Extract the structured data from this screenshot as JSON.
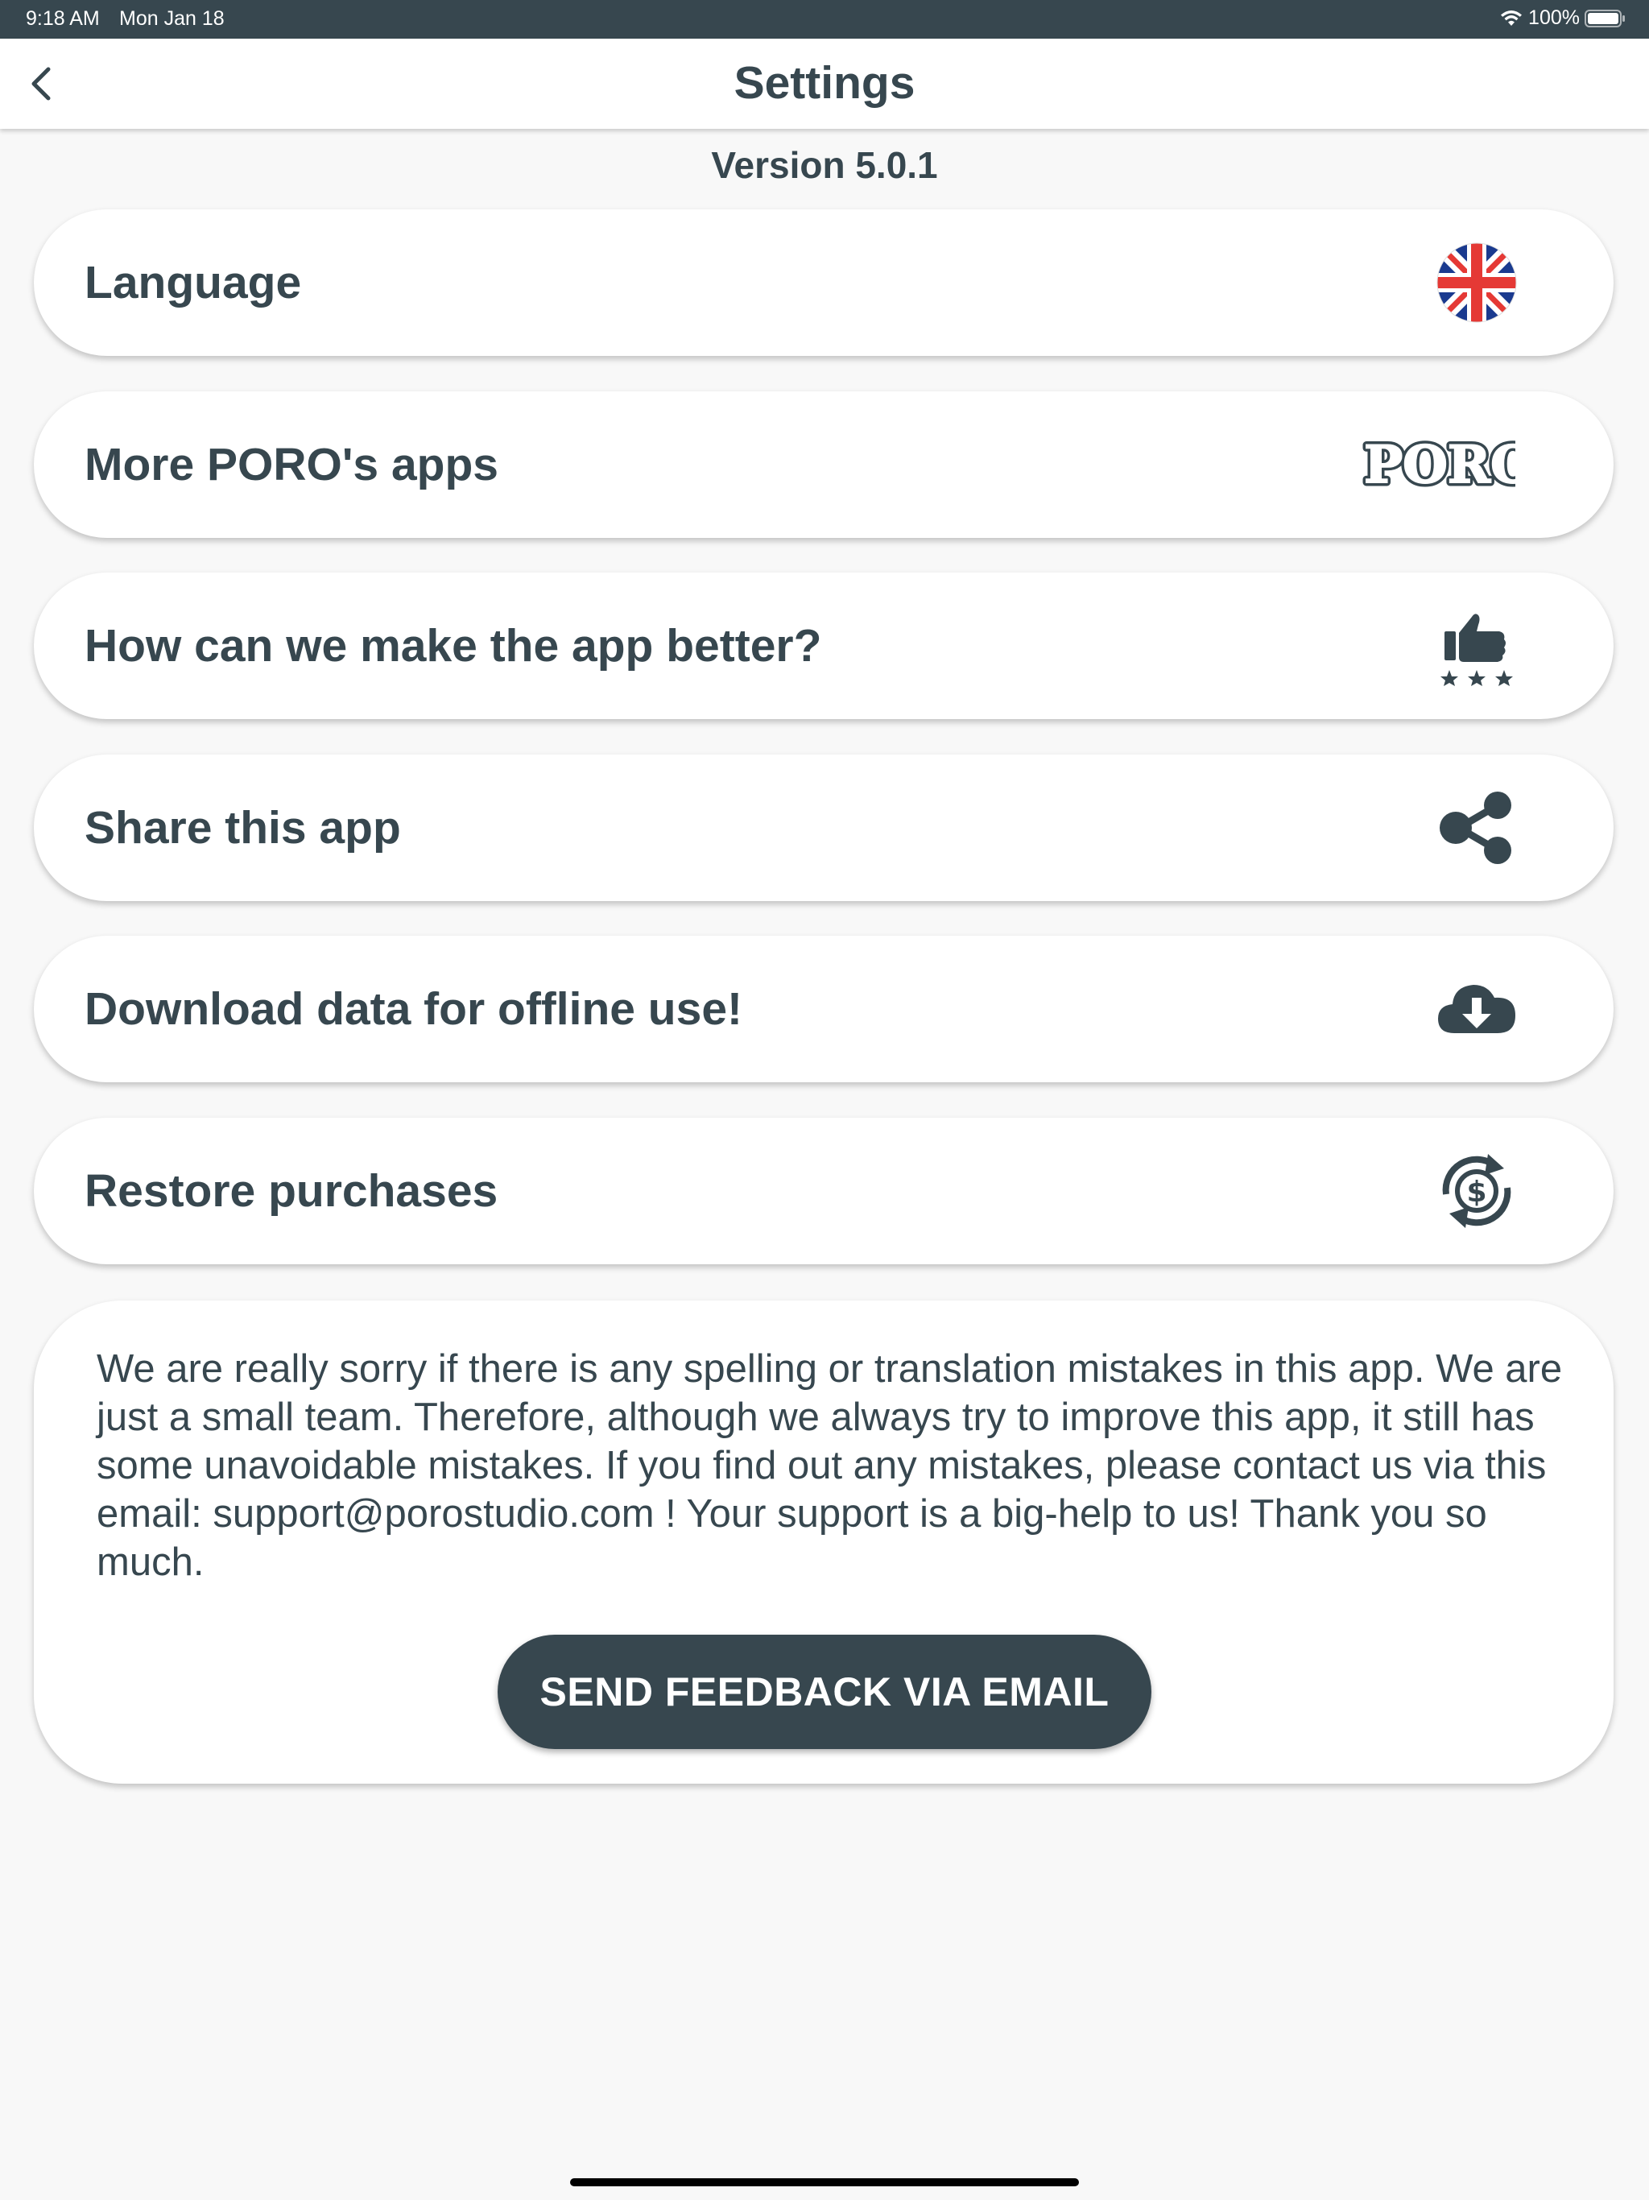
{
  "status_bar": {
    "time": "9:18 AM",
    "date": "Mon Jan 18",
    "battery": "100%",
    "icons": [
      "wifi-icon",
      "battery-icon"
    ]
  },
  "nav": {
    "title": "Settings",
    "back_icon": "chevron-left-icon"
  },
  "version": "Version 5.0.1",
  "menu": {
    "items": [
      {
        "label": "Language",
        "icon": "uk-flag-icon"
      },
      {
        "label": "More PORO's apps",
        "icon": "poro-logo"
      },
      {
        "label": "How can we make the app better?",
        "icon": "thumbs-up-stars-icon"
      },
      {
        "label": "Share this app",
        "icon": "share-icon"
      },
      {
        "label": "Download data for offline use!",
        "icon": "cloud-download-icon"
      },
      {
        "label": "Restore purchases",
        "icon": "restore-dollar-icon"
      }
    ]
  },
  "poro_logo_text": "PORO",
  "feedback": {
    "text": "We are really sorry if there is any spelling or translation mistakes in this app. We are just a small team. Therefore, although we always try to improve this app, it still has some unavoidable mistakes. If you find out any mistakes, please contact us via this email: support@porostudio.com ! Your support is a big-help to us! Thank you so much.",
    "button_label": "SEND FEEDBACK VIA EMAIL"
  },
  "colors": {
    "primary": "#37474f",
    "background": "#f8f8f8",
    "card": "#ffffff",
    "flag_blue": "#1a237e",
    "flag_red": "#e53935"
  }
}
